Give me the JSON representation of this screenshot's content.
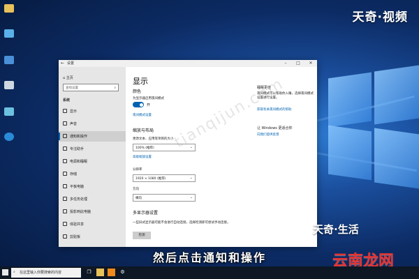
{
  "desktop": {
    "icons": [
      {
        "name": "desktop-icon-1",
        "label": ""
      },
      {
        "name": "desktop-icon-2",
        "label": ""
      },
      {
        "name": "desktop-icon-3",
        "label": ""
      },
      {
        "name": "desktop-icon-4",
        "label": ""
      },
      {
        "name": "desktop-icon-5",
        "label": ""
      },
      {
        "name": "desktop-icon-6",
        "label": ""
      }
    ]
  },
  "brand_top": "天奇·视频",
  "brand_bottom_1": "天奇·生活",
  "brand_bottom_2": "云南龙网",
  "watermark": "tianqijun.com",
  "subtitle": "然后点击通知和操作",
  "window": {
    "title": "设置",
    "sidebar": {
      "home": "主页",
      "search_placeholder": "查找设置",
      "section": "系统",
      "items": [
        "显示",
        "声音",
        "通知和操作",
        "专注助手",
        "电源和睡眠",
        "存储",
        "平板电脑",
        "多任务处理",
        "投影到此电脑",
        "体验共享",
        "剪贴板"
      ]
    },
    "content": {
      "title": "显示",
      "color_heading": "颜色",
      "night_light_desc": "为显示器启用夜间模式",
      "toggle_label": "开",
      "night_light_link": "夜间模式设置",
      "scale_heading": "缩放与布局",
      "scale_label": "更改文本、应用等项目的大小",
      "scale_value": "100% (推荐)",
      "scale_link": "高级缩放设置",
      "resolution_label": "分辨率",
      "resolution_value": "1920 × 1080 (推荐)",
      "orientation_label": "方向",
      "orientation_value": "横向",
      "multi_heading": "多显示器设置",
      "multi_desc": "一些旧式显示器可能不会进行自动连接，选择检测即可尝试手动连接。",
      "detect_button": "检测",
      "right_heading": "睡眠更佳",
      "right_desc": "夜间模式可以帮助你入睡，选择夜间模式设置进行设置。",
      "right_link": "获取有关夜间模式的帮助",
      "right_heading2": "让 Windows 更适合你",
      "right_link2": "向我们提供反馈"
    }
  },
  "taskbar": {
    "search_placeholder": "在这里输入你要搜索的内容"
  }
}
